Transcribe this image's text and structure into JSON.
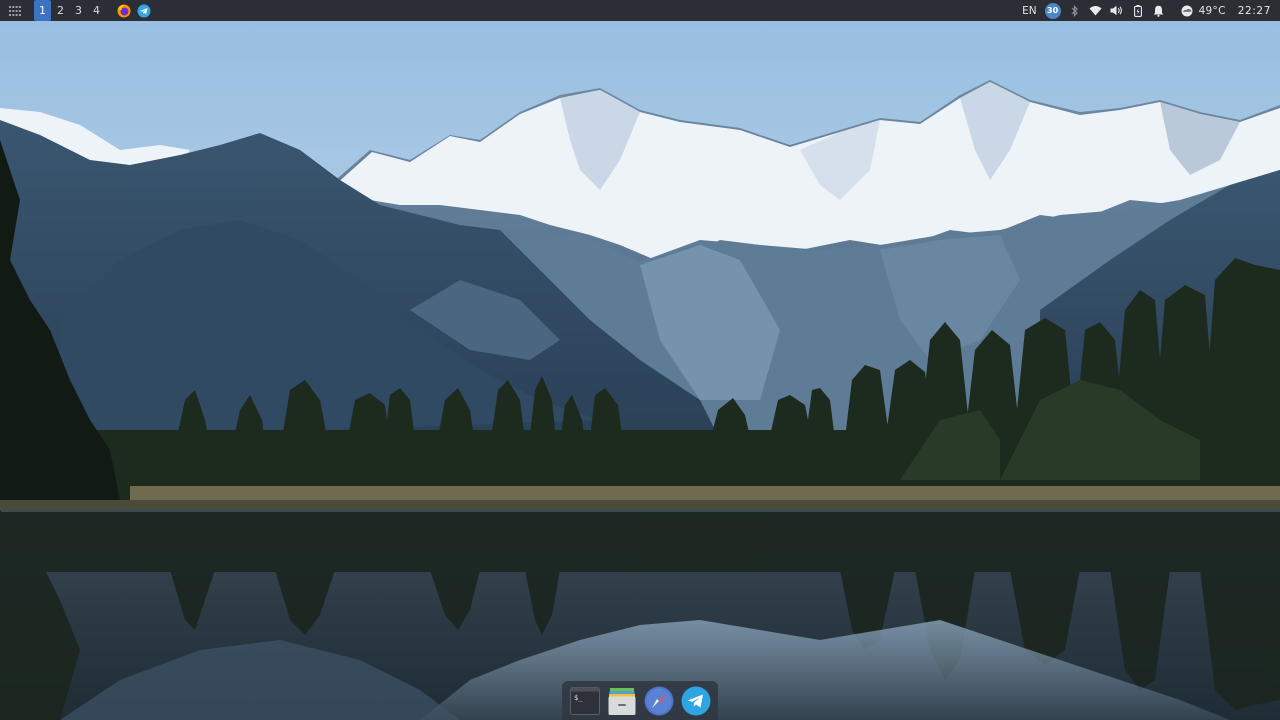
{
  "topbar": {
    "workspaces": [
      {
        "label": "1",
        "active": true
      },
      {
        "label": "2",
        "active": false
      },
      {
        "label": "3",
        "active": false
      },
      {
        "label": "4",
        "active": false
      }
    ],
    "running_apps": [
      "firefox-icon",
      "telegram-icon"
    ],
    "tray": {
      "keyboard_layout": "EN",
      "badge_count": "30",
      "icons": [
        "bluetooth-icon",
        "wifi-icon",
        "volume-icon",
        "battery-icon",
        "notification-bell-icon",
        "weather-icon"
      ],
      "temperature": "49°C",
      "clock": "22:27"
    }
  },
  "dock": {
    "items": [
      {
        "name": "terminal",
        "icon": "terminal-icon"
      },
      {
        "name": "files",
        "icon": "file-manager-icon"
      },
      {
        "name": "safari-browser",
        "icon": "compass-icon"
      },
      {
        "name": "telegram",
        "icon": "telegram-icon"
      }
    ]
  },
  "wallpaper": {
    "subject": "snow-capped mountains reflected in lake",
    "colors": {
      "sky": "#a9c9e6",
      "snow": "#eef3f8",
      "forest": "#1d2a1e",
      "water": "#2f3f4d"
    }
  },
  "colors": {
    "topbar_bg": "#2b2e35",
    "active_workspace": "#3b72c2",
    "dock_bg": "#303742"
  }
}
